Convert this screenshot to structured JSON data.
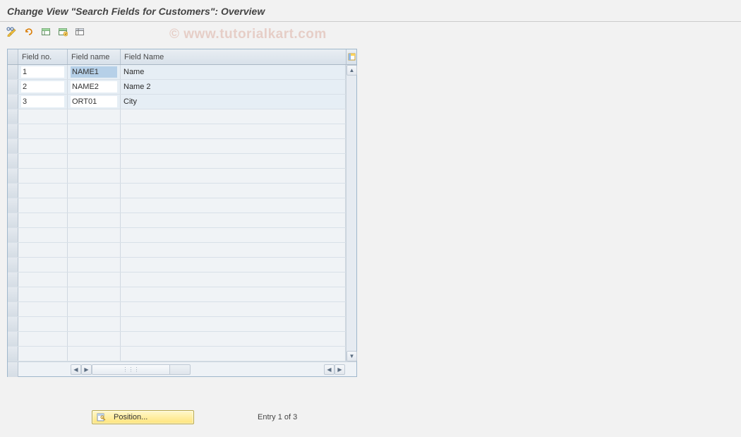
{
  "title": "Change View \"Search Fields for Customers\": Overview",
  "watermark": "© www.tutorialkart.com",
  "toolbar": {
    "items": [
      "change-display",
      "glasses",
      "new-entries",
      "copy",
      "delete"
    ]
  },
  "table": {
    "headers": {
      "sel": "",
      "no": "Field no.",
      "name": "Field name",
      "desc": "Field Name"
    },
    "rows": [
      {
        "no": "1",
        "name": "NAME1",
        "desc": "Name",
        "selected": true
      },
      {
        "no": "2",
        "name": "NAME2",
        "desc": "Name 2",
        "selected": false
      },
      {
        "no": "3",
        "name": "ORT01",
        "desc": "City",
        "selected": false
      }
    ],
    "empty_rows": 17,
    "config_icon": "table-settings"
  },
  "footer": {
    "position_label": "Position...",
    "entry_text": "Entry 1 of 3"
  }
}
